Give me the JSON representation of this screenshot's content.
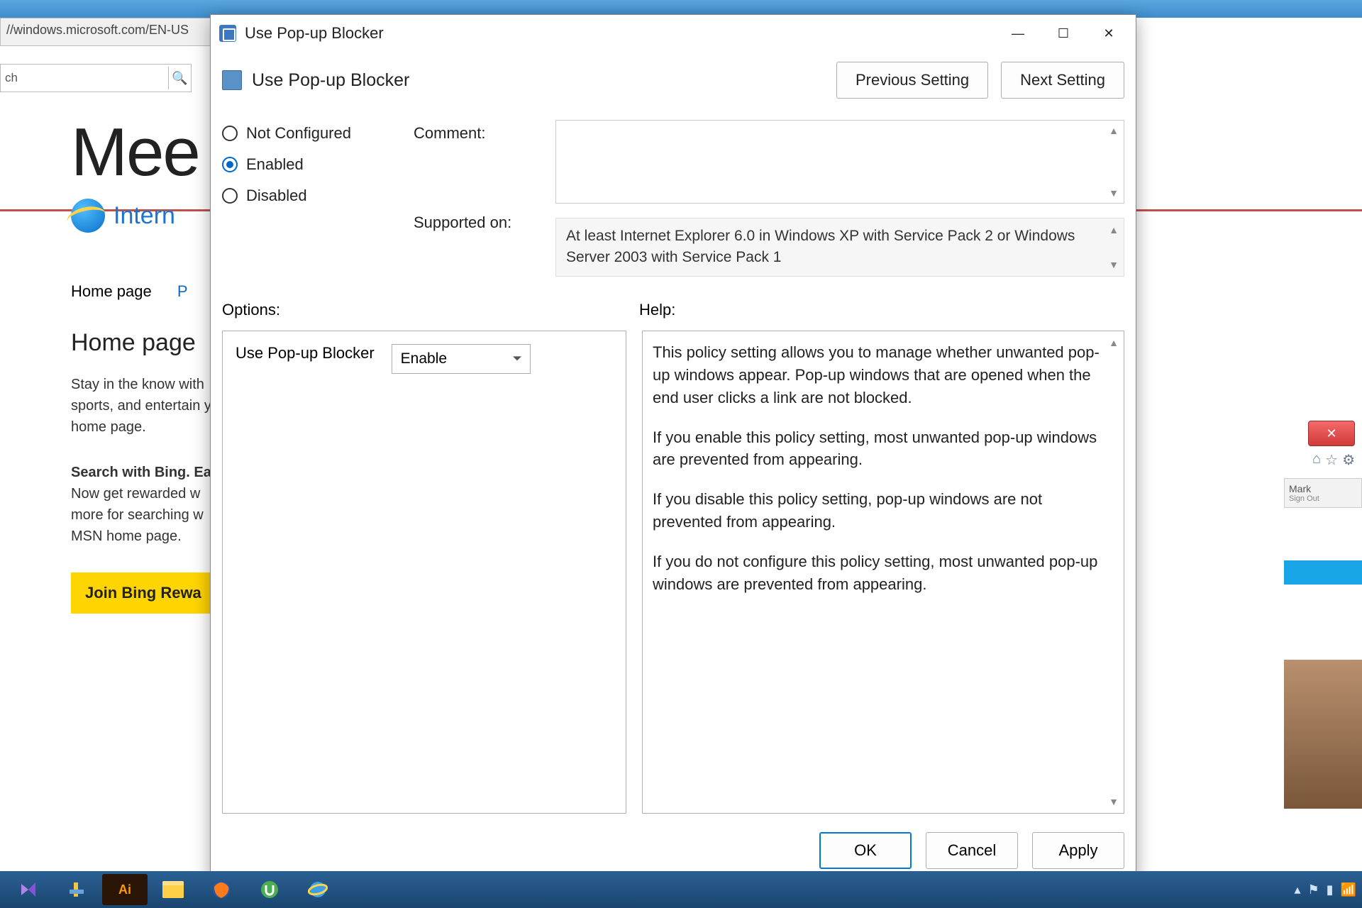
{
  "background": {
    "url_fragment": "//windows.microsoft.com/EN-US",
    "search_placeholder": "ch",
    "headline_partial": "Mee",
    "brand_text": "Intern",
    "tabs": {
      "active": "Home page",
      "next_partial": "P"
    },
    "section_title": "Home page",
    "para1": "Stay in the know with sports, and entertain your home page.",
    "para2": "Search with Bing. Ea Now get rewarded w more for searching w MSN home page.",
    "button": "Join Bing Rewa",
    "sidebar_user": "Mark",
    "sidebar_signout": "Sign Out"
  },
  "dialog": {
    "window_title": "Use Pop-up Blocker",
    "heading": "Use Pop-up Blocker",
    "nav": {
      "prev": "Previous Setting",
      "next": "Next Setting"
    },
    "radios": {
      "not_configured": "Not Configured",
      "enabled": "Enabled",
      "disabled": "Disabled",
      "selected": "enabled"
    },
    "labels": {
      "comment": "Comment:",
      "supported": "Supported on:",
      "options": "Options:",
      "help": "Help:"
    },
    "supported_text": "At least Internet Explorer 6.0 in Windows XP with Service Pack 2 or Windows Server 2003 with Service Pack 1",
    "option_row": {
      "label": "Use Pop-up Blocker",
      "value": "Enable"
    },
    "help_paragraphs": [
      "This policy setting allows you to manage whether unwanted pop-up windows appear. Pop-up windows that are opened when the end user clicks a link are not blocked.",
      "If you enable this policy setting, most unwanted pop-up windows are prevented from appearing.",
      "If you disable this policy setting, pop-up windows are not prevented from appearing.",
      "If you do not configure this policy setting, most unwanted pop-up windows are prevented from appearing."
    ],
    "buttons": {
      "ok": "OK",
      "cancel": "Cancel",
      "apply": "Apply"
    }
  }
}
